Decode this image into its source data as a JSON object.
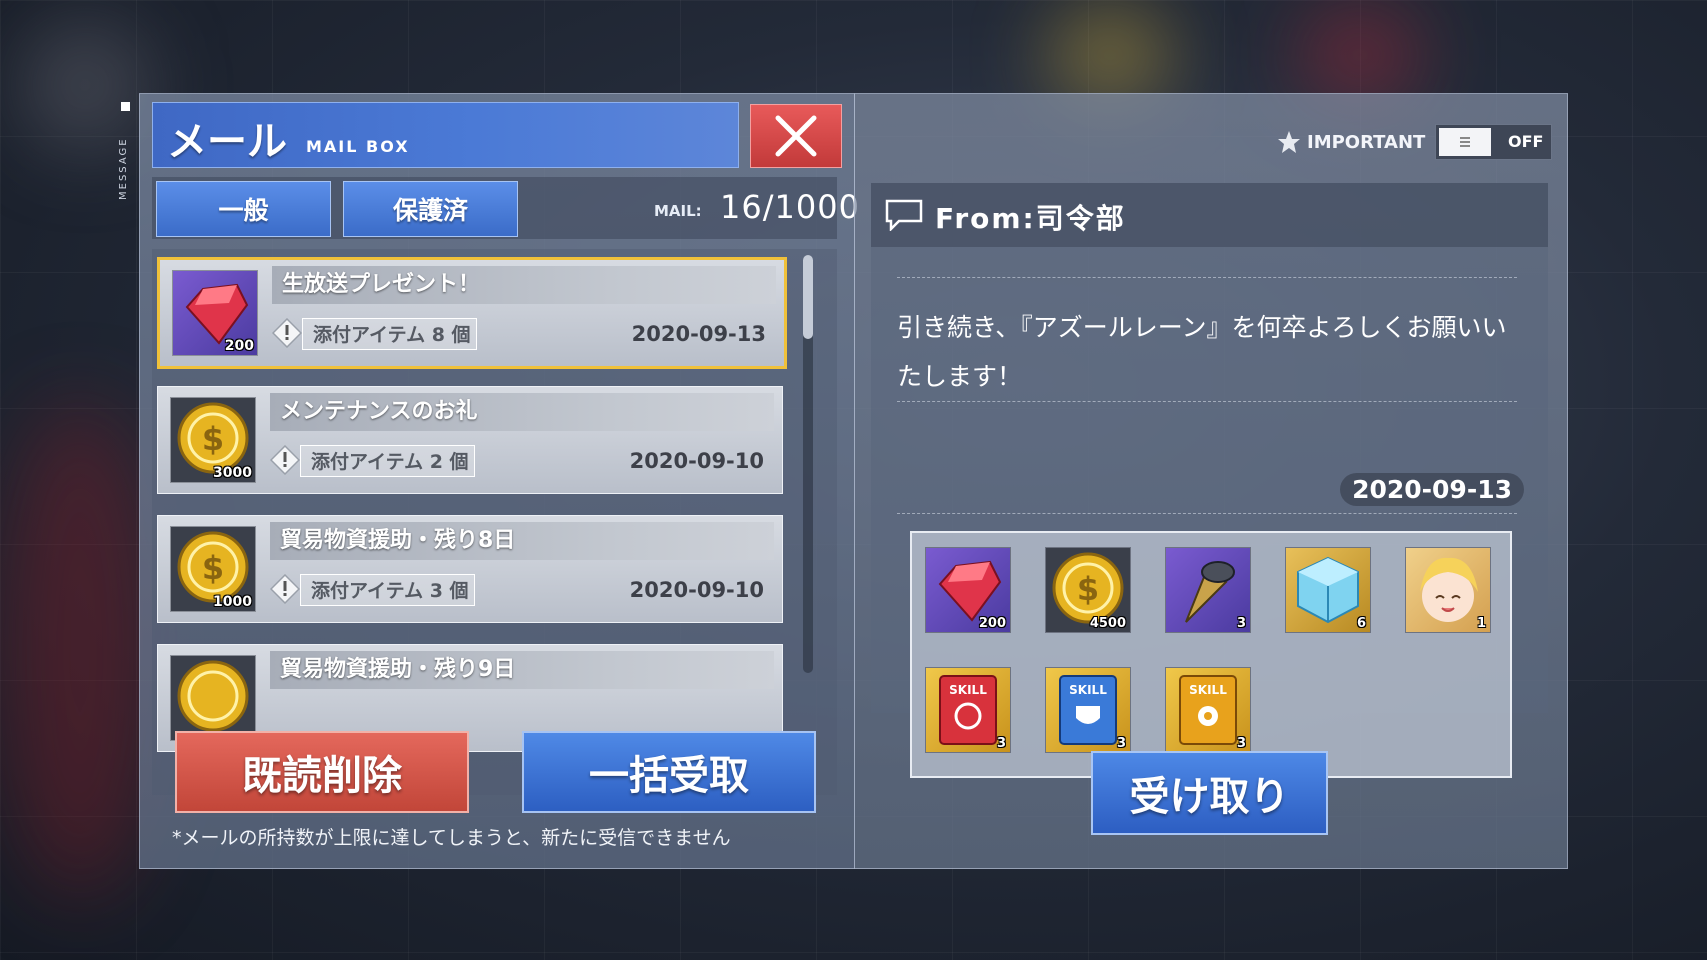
{
  "side_label": "MESSAGE",
  "left": {
    "title": "メール",
    "subtitle": "MAIL BOX",
    "tabs": [
      {
        "label": "一般"
      },
      {
        "label": "保護済"
      }
    ],
    "mail_count_label": "MAIL:",
    "mail_count": "16/1000",
    "mails": [
      {
        "subject": "生放送プレゼント！",
        "attach": "添付アイテム 8 個",
        "date": "2020-09-13",
        "icon": "gem-icon",
        "qty": "200",
        "selected": true
      },
      {
        "subject": "メンテナンスのお礼",
        "attach": "添付アイテム 2 個",
        "date": "2020-09-10",
        "icon": "gold-coin-icon",
        "qty": "3000",
        "selected": false
      },
      {
        "subject": "貿易物資援助・残り8日",
        "attach": "添付アイテム 3 個",
        "date": "2020-09-10",
        "icon": "gold-coin-icon",
        "qty": "1000",
        "selected": false
      },
      {
        "subject": "貿易物資援助・残り9日",
        "attach": "",
        "date": "",
        "icon": "gold-coin-icon",
        "qty": "",
        "selected": false
      }
    ],
    "delete_label": "既読削除",
    "claim_all_label": "一括受取",
    "notice": "*メールの所持数が上限に達してしまうと、新たに受信できません"
  },
  "right": {
    "important_label": "IMPORTANT",
    "toggle_state": "OFF",
    "from": "From:司令部",
    "message_lines": [
      "引き続き、『アズールレーン』を何卒よろしくお願いい",
      "たします！"
    ],
    "date": "2020-09-13",
    "rewards": [
      {
        "icon": "gem-icon",
        "qty": "200"
      },
      {
        "icon": "gold-coin-icon",
        "qty": "4500"
      },
      {
        "icon": "drill-icon",
        "qty": "3"
      },
      {
        "icon": "cube-icon",
        "qty": "6"
      },
      {
        "icon": "character-portrait-icon",
        "qty": "1"
      },
      {
        "icon": "skill-book-red-icon",
        "qty": "3"
      },
      {
        "icon": "skill-book-blue-icon",
        "qty": "3"
      },
      {
        "icon": "skill-book-gold-icon",
        "qty": "3"
      }
    ],
    "receive_label": "受け取り"
  },
  "colors": {
    "accent_blue": "#3b6cc8",
    "danger_red": "#c24639",
    "selected_gold": "#f0c13a"
  }
}
